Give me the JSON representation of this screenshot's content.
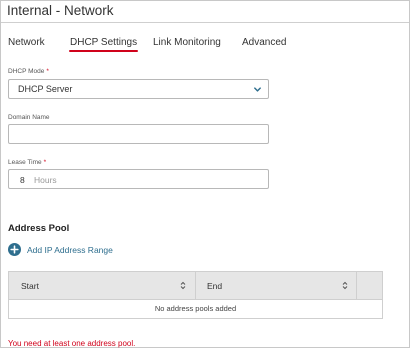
{
  "window": {
    "title": "Internal - Network"
  },
  "tabs": [
    {
      "label": "Network",
      "active": false
    },
    {
      "label": "DHCP Settings",
      "active": true
    },
    {
      "label": "Link Monitoring",
      "active": false
    },
    {
      "label": "Advanced",
      "active": false
    }
  ],
  "dhcp_mode": {
    "label": "DHCP Mode",
    "required": "*",
    "value": "DHCP Server"
  },
  "domain_name": {
    "label": "Domain Name",
    "value": ""
  },
  "lease_time": {
    "label": "Lease Time",
    "required": "*",
    "value": "8",
    "unit": "Hours"
  },
  "address_pool": {
    "title": "Address Pool",
    "add_label": "Add IP Address Range",
    "columns": [
      "Start",
      "End"
    ],
    "empty_message": "No address pools added"
  },
  "validation": {
    "error": "You need at least one address pool."
  },
  "colors": {
    "accent": "#d0021b",
    "link": "#2e6e8e",
    "header_bg": "#e6e6e6"
  }
}
